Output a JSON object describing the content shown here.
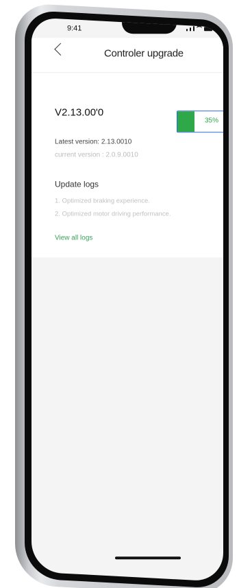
{
  "status_bar": {
    "time": "9:41"
  },
  "nav": {
    "title": "Controler upgrade",
    "back_icon": "chevron-left-icon"
  },
  "version": {
    "title": "V2.13.00'0",
    "progress_percent": 35,
    "progress_text": "35%",
    "latest_label": "Latest version",
    "latest_value": "2.13.0010",
    "current_label": "current version",
    "current_value": "2.0.9.0010"
  },
  "update_logs": {
    "title": "Update logs",
    "items": [
      "1. Optimized braking experience.",
      "2. Optimized motor driving performance."
    ],
    "view_all": "View all logs"
  },
  "colors": {
    "accent_green": "#2fa84a",
    "progress_border": "#2b6bd8"
  }
}
